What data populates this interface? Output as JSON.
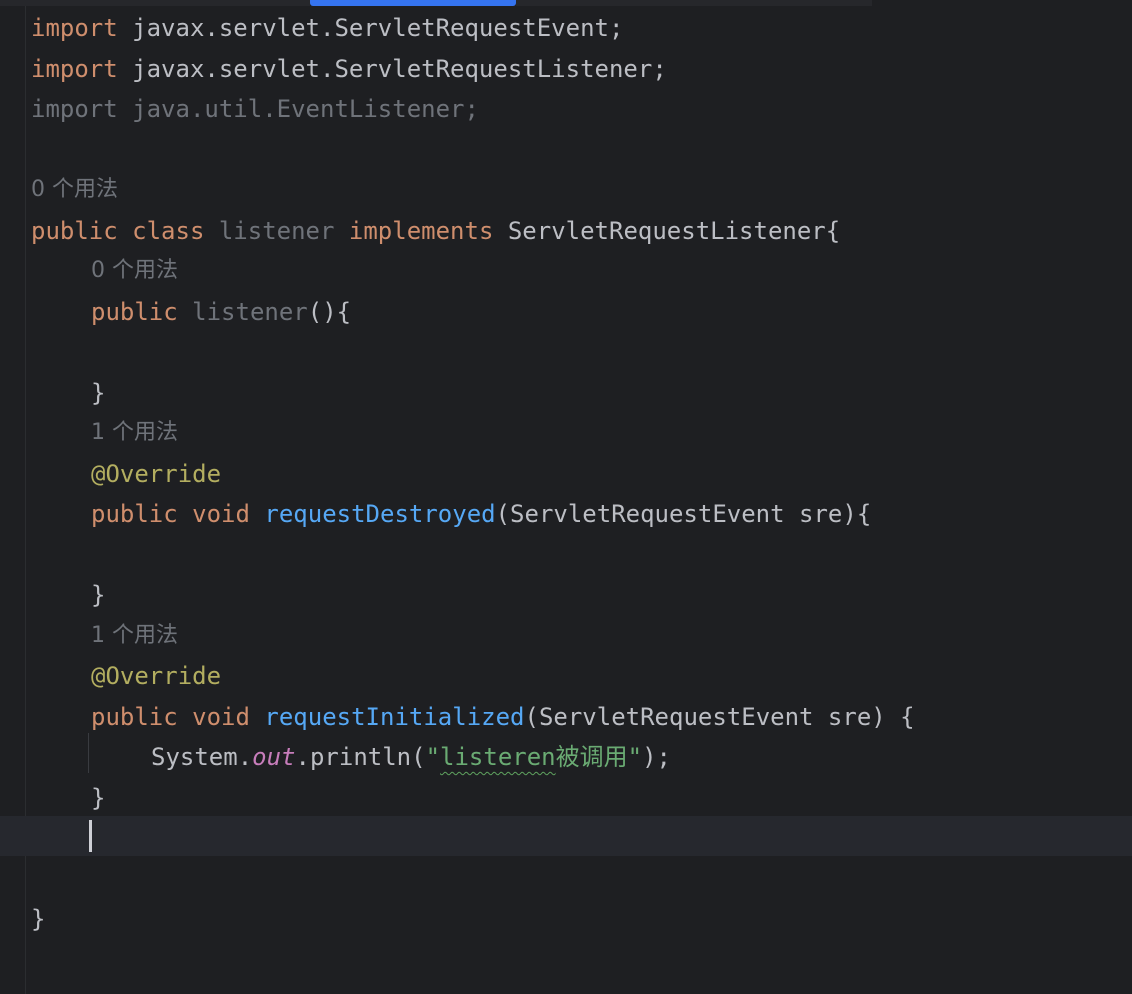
{
  "editor": {
    "lines": [
      {
        "parts": [
          "import",
          " javax.servlet.ServletRequestEvent;"
        ]
      },
      {
        "parts": [
          "import",
          " javax.servlet.ServletRequestListener;"
        ]
      },
      {
        "parts": [
          "import",
          " java.util.EventListener;"
        ]
      },
      {
        "hint": "0 个用法"
      },
      {
        "parts": [
          "public",
          " ",
          "class",
          " ",
          "listener",
          " ",
          "implements",
          " ServletRequestListener{"
        ]
      },
      {
        "hint": "0 个用法"
      },
      {
        "parts": [
          "public",
          " ",
          "listener",
          "(){"
        ]
      },
      {
        "parts": [
          "}"
        ]
      },
      {
        "hint": "1 个用法"
      },
      {
        "parts": [
          "@Override"
        ]
      },
      {
        "parts": [
          "public",
          " ",
          "void",
          " ",
          "requestDestroyed",
          "(ServletRequestEvent sre){"
        ]
      },
      {
        "parts": [
          "}"
        ]
      },
      {
        "hint": "1 个用法"
      },
      {
        "parts": [
          "@Override"
        ]
      },
      {
        "parts": [
          "public",
          " ",
          "void",
          " ",
          "requestInitialized",
          "(ServletRequestEvent sre) {"
        ]
      },
      {
        "parts": [
          "System.",
          "out",
          ".println(",
          "\"",
          "listeren",
          "被调用\"",
          ");"
        ]
      },
      {
        "parts": [
          "}"
        ]
      },
      {
        "parts": [
          "}"
        ]
      }
    ]
  }
}
